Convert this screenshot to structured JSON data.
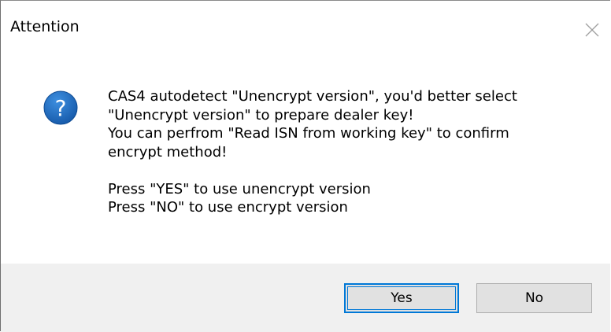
{
  "window": {
    "title": "Attention",
    "close_icon": "close-icon"
  },
  "message": {
    "icon": "question-icon",
    "icon_color": "#1d6fc1",
    "lines": [
      "CAS4 autodetect \"Unencrypt version\", you'd better select",
      "\"Unencrypt version\" to prepare dealer key!",
      "You can perfrom \"Read ISN from working key\" to confirm",
      "encrypt method!",
      "",
      "Press \"YES\" to use unencrypt version",
      "Press \"NO\" to use encrypt version"
    ]
  },
  "buttons": {
    "yes_label": "Yes",
    "no_label": "No",
    "focus_color": "#0078d7"
  }
}
